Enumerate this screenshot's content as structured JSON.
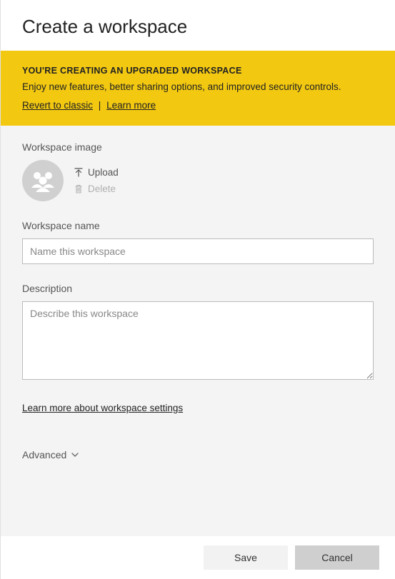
{
  "header": {
    "title": "Create a workspace"
  },
  "banner": {
    "title": "YOU'RE CREATING AN UPGRADED WORKSPACE",
    "text": "Enjoy new features, better sharing options, and improved security controls.",
    "revert_label": "Revert to classic",
    "separator": "|",
    "learn_label": "Learn more"
  },
  "image_section": {
    "label": "Workspace image",
    "upload_label": "Upload",
    "delete_label": "Delete"
  },
  "name_section": {
    "label": "Workspace name",
    "placeholder": "Name this workspace",
    "value": ""
  },
  "desc_section": {
    "label": "Description",
    "placeholder": "Describe this workspace",
    "value": ""
  },
  "settings_link": "Learn more about workspace settings",
  "advanced": {
    "label": "Advanced"
  },
  "footer": {
    "save_label": "Save",
    "cancel_label": "Cancel"
  }
}
